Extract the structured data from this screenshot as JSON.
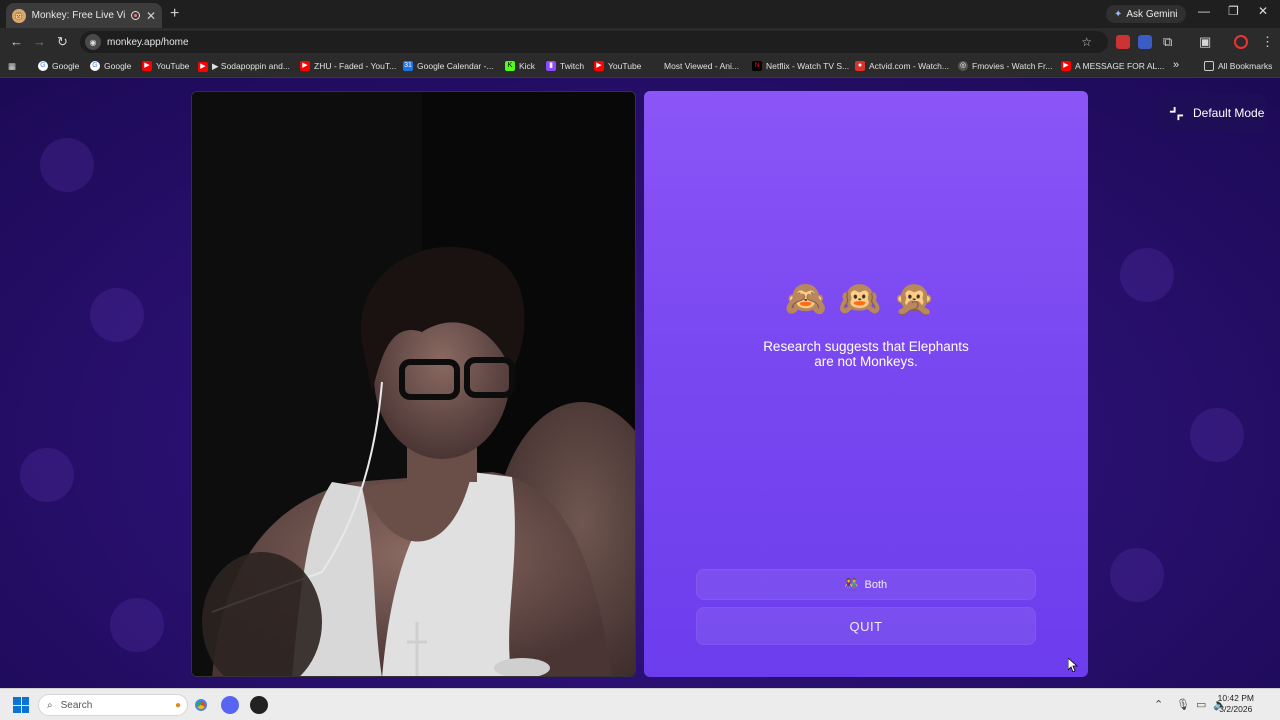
{
  "browser": {
    "tab_title": "Monkey: Free Live Video Chat",
    "tab_favicon": "monkey-icon",
    "new_tab": "+",
    "ask_gemini": "Ask Gemini",
    "url": "monkey.app/home",
    "window_controls": [
      "—",
      "❐",
      "✕"
    ]
  },
  "bookmarks": [
    {
      "label": "Google",
      "icon": "google-icon",
      "color": "#4285f4"
    },
    {
      "label": "Google",
      "icon": "google-icon",
      "color": "#4285f4"
    },
    {
      "label": "YouTube",
      "icon": "youtube-icon",
      "color": "#ff0000"
    },
    {
      "label": "▶ Sodapoppin and...",
      "icon": "youtube-icon",
      "color": "#ff0000"
    },
    {
      "label": "ZHU - Faded - YouT...",
      "icon": "youtube-icon",
      "color": "#ff0000"
    },
    {
      "label": "Google Calendar -...",
      "icon": "calendar-icon",
      "color": "#1a73e8"
    },
    {
      "label": "Kick",
      "icon": "kick-icon",
      "color": "#53fc18"
    },
    {
      "label": "Twitch",
      "icon": "twitch-icon",
      "color": "#9146ff"
    },
    {
      "label": "YouTube",
      "icon": "youtube-icon",
      "color": "#ff0000"
    },
    {
      "label": "Most Viewed - Ani...",
      "icon": "",
      "color": ""
    },
    {
      "label": "Netflix - Watch TV S...",
      "icon": "netflix-icon",
      "color": "#e50914"
    },
    {
      "label": "Actvid.com - Watch...",
      "icon": "actvid-icon",
      "color": "#d8322b"
    },
    {
      "label": "Fmovies - Watch Fr...",
      "icon": "fmovies-icon",
      "color": "#cfcfcf"
    },
    {
      "label": "A MESSAGE FOR AL...",
      "icon": "youtube-icon",
      "color": "#ff0000"
    }
  ],
  "all_bookmarks": "All Bookmarks",
  "overflow": "»",
  "panel": {
    "emojis": [
      "🙈",
      "🙉",
      "🙊"
    ],
    "fact": "Research suggests that Elephants are not Monkeys.",
    "gender_button": "Both",
    "quit_button": "QUIT"
  },
  "mode_button": "Default Mode",
  "taskbar": {
    "search": "Search",
    "time": "10:42 PM",
    "date": "3/2/2026"
  },
  "colors": {
    "panel_purple": "#7a48f1",
    "page_bg": "#2a1072"
  }
}
